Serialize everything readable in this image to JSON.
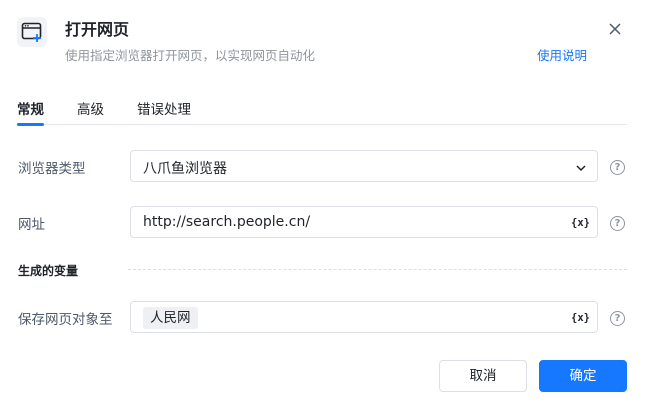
{
  "dialog": {
    "icon": "browser-add-icon",
    "title": "打开网页",
    "subtitle": "使用指定浏览器打开网页，以实现网页自动化",
    "help_link": "使用说明",
    "close_icon": "close-icon"
  },
  "tabs": [
    {
      "label": "常规",
      "active": true
    },
    {
      "label": "高级",
      "active": false
    },
    {
      "label": "错误处理",
      "active": false
    }
  ],
  "form": {
    "browser_type": {
      "label": "浏览器类型",
      "value": "八爪鱼浏览器",
      "icon": "chevron-down-icon"
    },
    "url": {
      "label": "网址",
      "value": "http://search.people.cn/",
      "icon": "variable-icon",
      "icon_text": "{x}"
    },
    "section_title": "生成的变量",
    "save_to": {
      "label": "保存网页对象至",
      "value": "人民网",
      "icon": "variable-icon",
      "icon_text": "{x}"
    },
    "help_icon_text": "?"
  },
  "buttons": {
    "cancel": "取消",
    "ok": "确定"
  },
  "colors": {
    "accent": "#1677ff",
    "border": "#dcdfe6",
    "muted_text": "#8f959e"
  }
}
